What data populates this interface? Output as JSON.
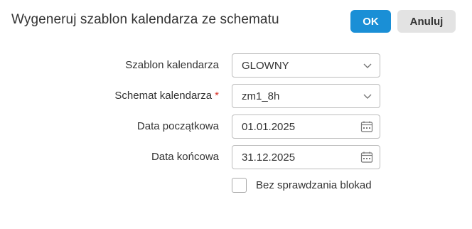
{
  "dialog": {
    "title": "Wygeneruj szablon kalendarza ze schematu",
    "ok_label": "OK",
    "cancel_label": "Anuluj"
  },
  "form": {
    "template": {
      "label": "Szablon kalendarza",
      "value": "GLOWNY",
      "icon": "chevron-down-icon"
    },
    "schema": {
      "label": "Schemat kalendarza",
      "required_mark": "*",
      "value": "zm1_8h",
      "icon": "chevron-down-icon"
    },
    "start_date": {
      "label": "Data początkowa",
      "value": "01.01.2025",
      "icon": "calendar-icon"
    },
    "end_date": {
      "label": "Data końcowa",
      "value": "31.12.2025",
      "icon": "calendar-icon"
    },
    "skip_lock_check": {
      "label": "Bez sprawdzania blokad",
      "checked": false
    }
  },
  "colors": {
    "primary": "#1a8fd6",
    "secondary_button": "#e3e3e3",
    "required": "#d9342b",
    "border": "#bdbdbd"
  }
}
